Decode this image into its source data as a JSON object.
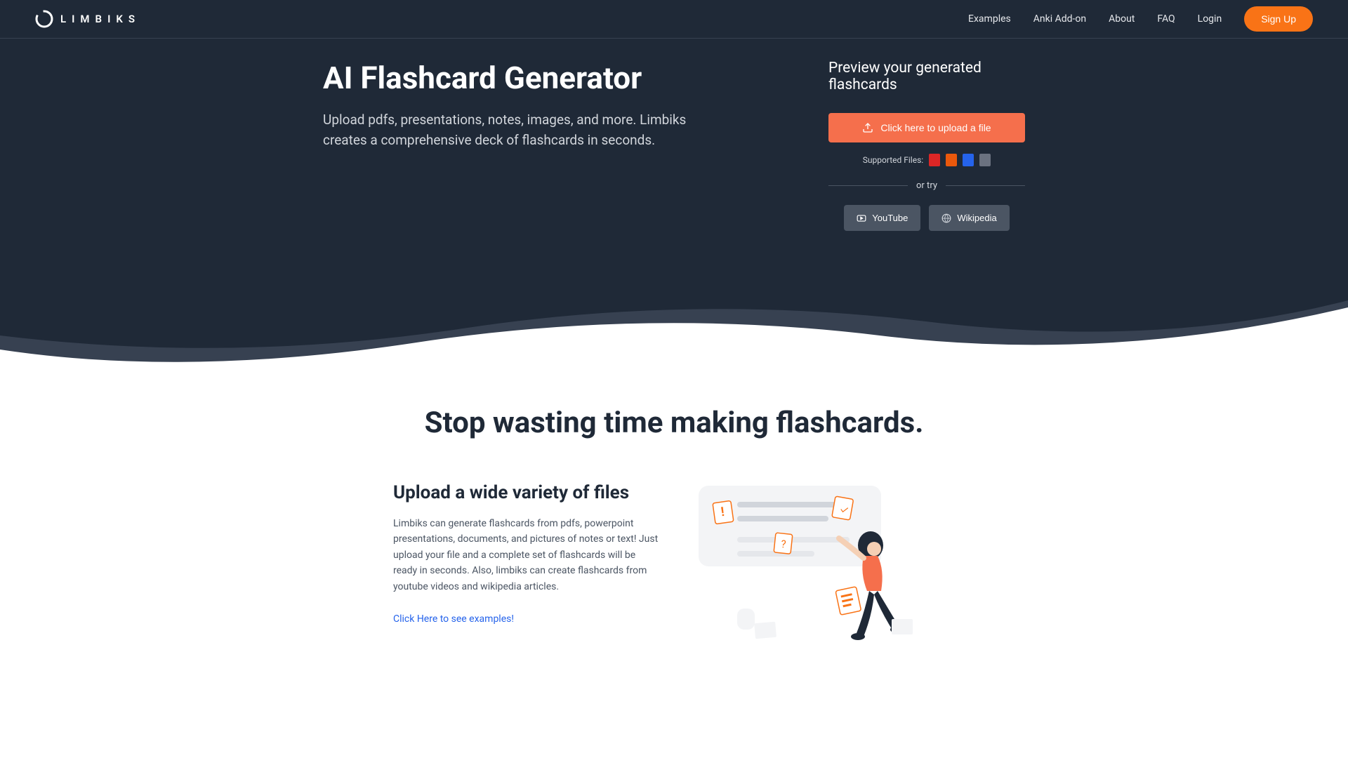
{
  "brand": "LIMBIKS",
  "nav": {
    "examples": "Examples",
    "anki": "Anki Add-on",
    "about": "About",
    "faq": "FAQ",
    "login": "Login",
    "signup": "Sign Up"
  },
  "hero": {
    "title": "AI Flashcard Generator",
    "subtitle": "Upload pdfs, presentations, notes, images, and more. Limbiks creates a comprehensive deck of flashcards in seconds."
  },
  "preview": {
    "title": "Preview your generated flashcards",
    "upload_label": "Click here to upload a file",
    "supported_label": "Supported Files:",
    "or_try": "or try",
    "youtube": "YouTube",
    "wikipedia": "Wikipedia"
  },
  "section2": {
    "headline": "Stop wasting time making flashcards.",
    "feature_title": "Upload a wide variety of files",
    "feature_desc": "Limbiks can generate flashcards from pdfs, powerpoint presentations, documents, and pictures of notes or text! Just upload your file and a complete set of flashcards will be ready in seconds. Also, limbiks can create flashcards from youtube videos and wikipedia articles.",
    "examples_link": "Click Here to see examples!"
  }
}
